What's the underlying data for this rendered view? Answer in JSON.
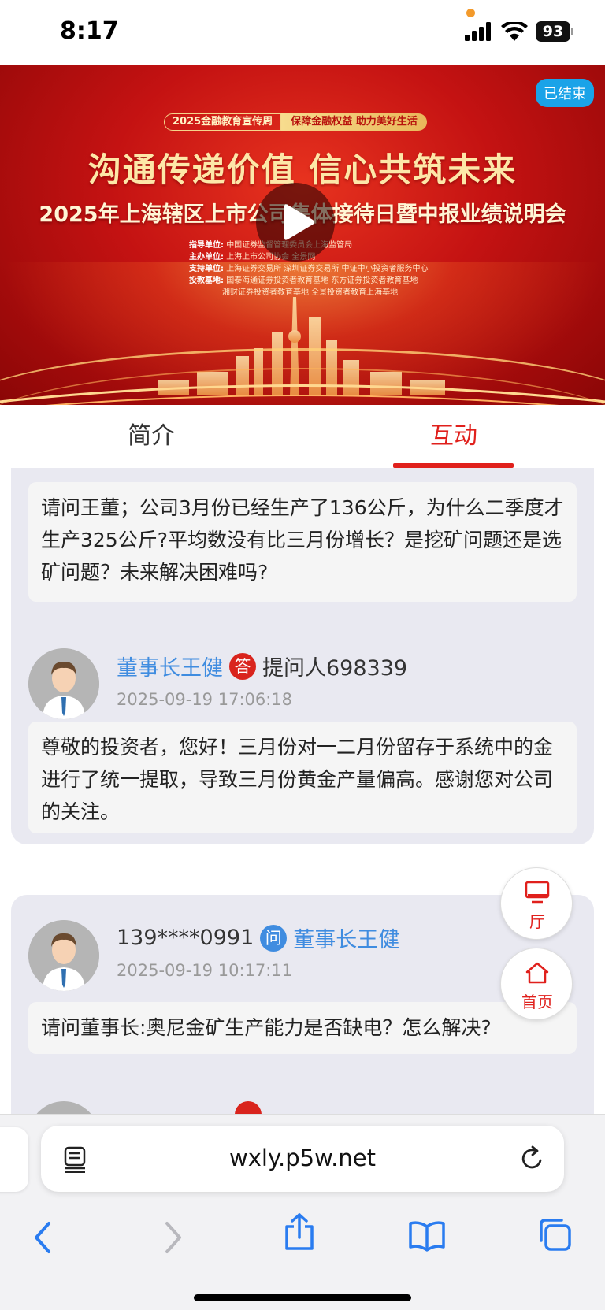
{
  "status_bar": {
    "time": "8:17",
    "battery": "93"
  },
  "video": {
    "status_badge": "已结束",
    "tag_left": "2025金融教育宣传周",
    "tag_right": "保障金融权益 助力美好生活",
    "slogan": "沟通传递价值 信心共筑未来",
    "title": "2025年上海辖区上市公司集体接待日暨中报业绩说明会",
    "info_lines": [
      {
        "label": "指导单位:",
        "text": "中国证券监督管理委员会上海监管局"
      },
      {
        "label": "主办单位:",
        "text": "上海上市公司协会 全景网"
      },
      {
        "label": "支持单位:",
        "text": "上海证券交易所 深圳证券交易所 中证中小投资者服务中心"
      },
      {
        "label": "投教基地:",
        "text": "国泰海通证券投资者教育基地 东方证券投资者教育基地"
      },
      {
        "label": "",
        "text": "湘财证券投资者教育基地 全景投资者教育上海基地"
      }
    ]
  },
  "tabs": [
    {
      "label": "简介",
      "active": false
    },
    {
      "label": "互动",
      "active": true
    }
  ],
  "qa": [
    {
      "question_text": "请问王董；公司3月份已经生产了136公斤，为什么二季度才生产325公斤?平均数没有比三月份增长？是挖矿问题还是选矿问题？未来解决困难吗?",
      "answer": {
        "responder": "董事长王健",
        "badge": "答",
        "to": "提问人698339",
        "time": "2025-09-19 17:06:18",
        "text": "尊敬的投资者，您好！三月份对一二月份留存于系统中的金进行了统一提取，导致三月份黄金产量偏高。感谢您对公司的关注。"
      }
    },
    {
      "asker": "139****0991",
      "badge": "问",
      "to": "董事长王健",
      "time": "2025-09-19 10:17:11",
      "question_text": "请问董事长:奥尼金矿生产能力是否缺电？怎么解决?"
    }
  ],
  "float_buttons": {
    "hall": "厅",
    "home": "首页"
  },
  "browser": {
    "url": "wxly.p5w.net"
  },
  "colors": {
    "accent_red": "#e0201c",
    "link_blue": "#3f8ce0",
    "card_bg": "#e9e9f1"
  },
  "icons": [
    "signal-icon",
    "wifi-icon",
    "battery-icon",
    "play-icon",
    "avatar-icon",
    "monitor-icon",
    "home-icon",
    "reader-icon",
    "reload-icon",
    "back-icon",
    "forward-icon",
    "share-icon",
    "bookmarks-icon",
    "tabs-icon"
  ]
}
